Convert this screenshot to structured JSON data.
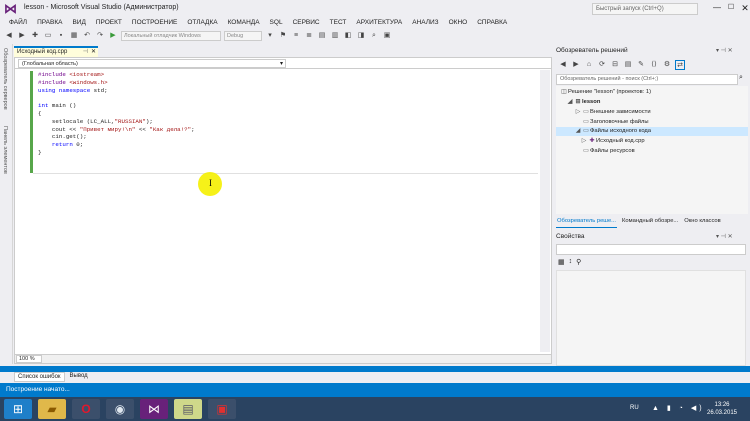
{
  "window": {
    "title": "lesson - Microsoft Visual Studio (Администратор)",
    "quick_launch_placeholder": "Быстрый запуск (Ctrl+Q)",
    "minimize_glyph": "—",
    "maximize_glyph": "☐",
    "close_glyph": "✕"
  },
  "menu": [
    "ФАЙЛ",
    "ПРАВКА",
    "ВИД",
    "ПРОЕКТ",
    "ПОСТРОЕНИЕ",
    "ОТЛАДКА",
    "КОМАНДА",
    "SQL",
    "СЕРВИС",
    "ТЕСТ",
    "АРХИТЕКТУРА",
    "АНАЛИЗ",
    "ОКНО",
    "СПРАВКА"
  ],
  "toolbar": {
    "debugger_combo": "Локальный отладчик Windows",
    "config_combo": "Debug"
  },
  "left_strip": {
    "server_explorer": "Обозреватель серверов",
    "toolbox": "Панель элементов"
  },
  "editor": {
    "tab_label": "Исходный код.cpp",
    "pin_glyph": "⊣",
    "close_glyph": "✕",
    "scope": "(Глобальная область)",
    "zoom": "100 %",
    "lines": [
      "#include <iostream>",
      "#include <windows.h>",
      "using namespace std;",
      "",
      "int main ()",
      "{",
      "    setlocale (LC_ALL,\"RUSSIAN\");",
      "    cout << \"Привет миру!\\n\" << \"Как дела!?\";",
      "    cin.get();",
      "    return 0;",
      "}"
    ]
  },
  "bottom_tabs": [
    "Список ошибок",
    "Вывод"
  ],
  "status": {
    "text": "Построение начато..."
  },
  "solution_explorer": {
    "title": "Обозреватель решений",
    "search_placeholder": "Обозреватель решений - поиск (Ctrl+;)",
    "tree": [
      {
        "label": "Решение \"lesson\" (проектов: 1)",
        "indent": 0,
        "icon": "solution-icon"
      },
      {
        "label": "lesson",
        "indent": 1,
        "icon": "project-icon"
      },
      {
        "label": "Внешние зависимости",
        "indent": 2,
        "icon": "folder-icon"
      },
      {
        "label": "Заголовочные файлы",
        "indent": 2,
        "icon": "folder-icon"
      },
      {
        "label": "Файлы исходного кода",
        "indent": 2,
        "icon": "folder-icon"
      },
      {
        "label": "Исходный код.cpp",
        "indent": 3,
        "icon": "cpp-file-icon"
      },
      {
        "label": "Файлы ресурсов",
        "indent": 2,
        "icon": "folder-icon"
      }
    ],
    "tabs": [
      "Обозреватель реше...",
      "Командный обозре...",
      "Окно классов"
    ]
  },
  "properties": {
    "title": "Свойства"
  },
  "taskbar": {
    "lang": "RU",
    "time": "13:26",
    "date": "26.03.2015",
    "apps": [
      "explorer-icon",
      "opera-icon",
      "steam-icon",
      "visual-studio-icon",
      "notes-icon",
      "media-icon"
    ]
  },
  "colors": {
    "accent": "#007acc",
    "taskbar": "#2a4361",
    "vs_purple": "#68217a"
  }
}
